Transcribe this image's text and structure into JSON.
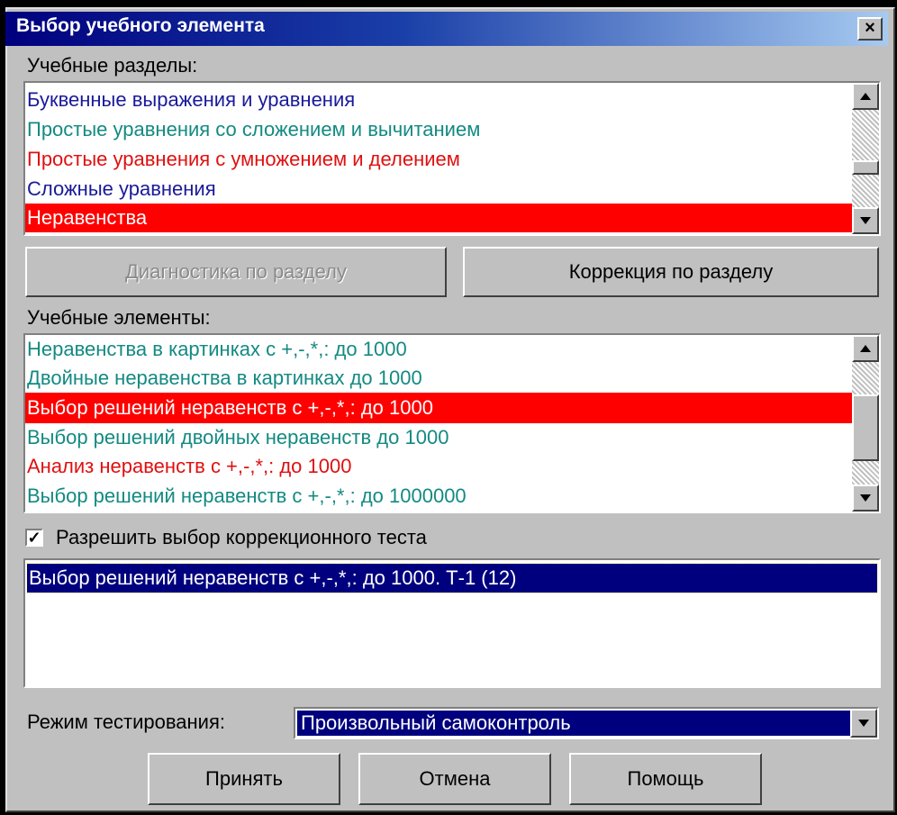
{
  "window": {
    "title": "Выбор учебного элемента",
    "close_glyph": "×"
  },
  "sections": {
    "label": "Учебные разделы:",
    "items": [
      {
        "label": "Буквенные выражения и уравнения",
        "color": "#1a1a9a"
      },
      {
        "label": "Простые уравнения со сложением и вычитанием",
        "color": "#138a82"
      },
      {
        "label": "Простые уравнения с умножением и делением",
        "color": "#e01010"
      },
      {
        "label": "Сложные уравнения",
        "color": "#1a1a9a"
      },
      {
        "label": "Неравенства",
        "color": "#ffffff",
        "selected": true
      }
    ]
  },
  "buttons": {
    "diagnostics": "Диагностика по разделу",
    "correction": "Коррекция по разделу",
    "accept": "Принять",
    "cancel": "Отмена",
    "help": "Помощь"
  },
  "elements": {
    "label": "Учебные элементы:",
    "items": [
      {
        "label": "Неравенства в картинках с +,-,*,: до 1000",
        "color": "#138a82"
      },
      {
        "label": "Двойные неравенства в картинках до 1000",
        "color": "#138a82"
      },
      {
        "label": "Выбор решений неравенств с +,-,*,: до 1000",
        "color": "#ffffff",
        "selected": true
      },
      {
        "label": "Выбор решений двойных неравенств до 1000",
        "color": "#138a82"
      },
      {
        "label": "Анализ неравенств с +,-,*,: до 1000",
        "color": "#e01010"
      },
      {
        "label": "Выбор решений неравенств с +,-,*,: до 1000000",
        "color": "#138a82"
      }
    ]
  },
  "allow_correction": {
    "label": "Разрешить выбор коррекционного теста",
    "checked": true,
    "check_glyph": "✓"
  },
  "tests": {
    "items": [
      {
        "label": "Выбор решений неравенств с +,-,*,: до 1000. Т-1 (12)",
        "selected": true
      }
    ]
  },
  "mode": {
    "label": "Режим тестирования:",
    "value": "Произвольный самоконтроль"
  },
  "colors": {
    "selection_red": "#ff0000",
    "selection_navy": "#00007e"
  },
  "icons": {
    "scroll_up": "triangle-up-icon",
    "scroll_down": "triangle-down-icon",
    "combo": "chevron-down-icon"
  }
}
